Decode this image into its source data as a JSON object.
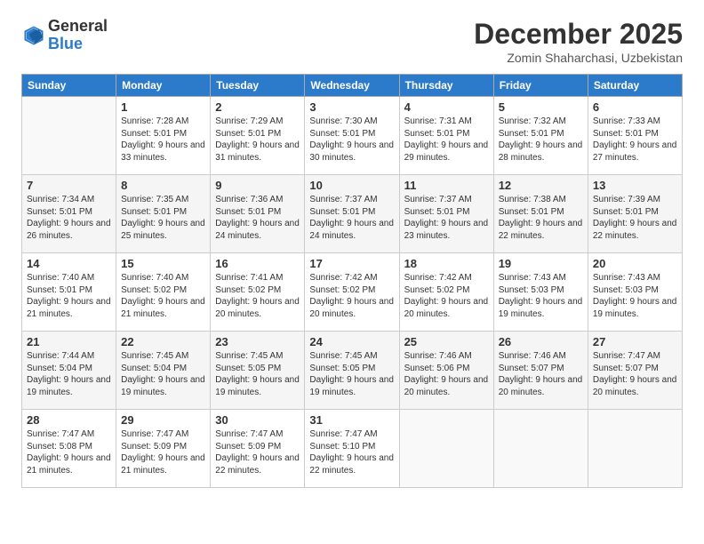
{
  "header": {
    "logo_general": "General",
    "logo_blue": "Blue",
    "month_title": "December 2025",
    "location": "Zomin Shaharchasi, Uzbekistan"
  },
  "days_of_week": [
    "Sunday",
    "Monday",
    "Tuesday",
    "Wednesday",
    "Thursday",
    "Friday",
    "Saturday"
  ],
  "weeks": [
    [
      {
        "day": "",
        "sunrise": "",
        "sunset": "",
        "daylight": ""
      },
      {
        "day": "1",
        "sunrise": "Sunrise: 7:28 AM",
        "sunset": "Sunset: 5:01 PM",
        "daylight": "Daylight: 9 hours and 33 minutes."
      },
      {
        "day": "2",
        "sunrise": "Sunrise: 7:29 AM",
        "sunset": "Sunset: 5:01 PM",
        "daylight": "Daylight: 9 hours and 31 minutes."
      },
      {
        "day": "3",
        "sunrise": "Sunrise: 7:30 AM",
        "sunset": "Sunset: 5:01 PM",
        "daylight": "Daylight: 9 hours and 30 minutes."
      },
      {
        "day": "4",
        "sunrise": "Sunrise: 7:31 AM",
        "sunset": "Sunset: 5:01 PM",
        "daylight": "Daylight: 9 hours and 29 minutes."
      },
      {
        "day": "5",
        "sunrise": "Sunrise: 7:32 AM",
        "sunset": "Sunset: 5:01 PM",
        "daylight": "Daylight: 9 hours and 28 minutes."
      },
      {
        "day": "6",
        "sunrise": "Sunrise: 7:33 AM",
        "sunset": "Sunset: 5:01 PM",
        "daylight": "Daylight: 9 hours and 27 minutes."
      }
    ],
    [
      {
        "day": "7",
        "sunrise": "Sunrise: 7:34 AM",
        "sunset": "Sunset: 5:01 PM",
        "daylight": "Daylight: 9 hours and 26 minutes."
      },
      {
        "day": "8",
        "sunrise": "Sunrise: 7:35 AM",
        "sunset": "Sunset: 5:01 PM",
        "daylight": "Daylight: 9 hours and 25 minutes."
      },
      {
        "day": "9",
        "sunrise": "Sunrise: 7:36 AM",
        "sunset": "Sunset: 5:01 PM",
        "daylight": "Daylight: 9 hours and 24 minutes."
      },
      {
        "day": "10",
        "sunrise": "Sunrise: 7:37 AM",
        "sunset": "Sunset: 5:01 PM",
        "daylight": "Daylight: 9 hours and 24 minutes."
      },
      {
        "day": "11",
        "sunrise": "Sunrise: 7:37 AM",
        "sunset": "Sunset: 5:01 PM",
        "daylight": "Daylight: 9 hours and 23 minutes."
      },
      {
        "day": "12",
        "sunrise": "Sunrise: 7:38 AM",
        "sunset": "Sunset: 5:01 PM",
        "daylight": "Daylight: 9 hours and 22 minutes."
      },
      {
        "day": "13",
        "sunrise": "Sunrise: 7:39 AM",
        "sunset": "Sunset: 5:01 PM",
        "daylight": "Daylight: 9 hours and 22 minutes."
      }
    ],
    [
      {
        "day": "14",
        "sunrise": "Sunrise: 7:40 AM",
        "sunset": "Sunset: 5:01 PM",
        "daylight": "Daylight: 9 hours and 21 minutes."
      },
      {
        "day": "15",
        "sunrise": "Sunrise: 7:40 AM",
        "sunset": "Sunset: 5:02 PM",
        "daylight": "Daylight: 9 hours and 21 minutes."
      },
      {
        "day": "16",
        "sunrise": "Sunrise: 7:41 AM",
        "sunset": "Sunset: 5:02 PM",
        "daylight": "Daylight: 9 hours and 20 minutes."
      },
      {
        "day": "17",
        "sunrise": "Sunrise: 7:42 AM",
        "sunset": "Sunset: 5:02 PM",
        "daylight": "Daylight: 9 hours and 20 minutes."
      },
      {
        "day": "18",
        "sunrise": "Sunrise: 7:42 AM",
        "sunset": "Sunset: 5:02 PM",
        "daylight": "Daylight: 9 hours and 20 minutes."
      },
      {
        "day": "19",
        "sunrise": "Sunrise: 7:43 AM",
        "sunset": "Sunset: 5:03 PM",
        "daylight": "Daylight: 9 hours and 19 minutes."
      },
      {
        "day": "20",
        "sunrise": "Sunrise: 7:43 AM",
        "sunset": "Sunset: 5:03 PM",
        "daylight": "Daylight: 9 hours and 19 minutes."
      }
    ],
    [
      {
        "day": "21",
        "sunrise": "Sunrise: 7:44 AM",
        "sunset": "Sunset: 5:04 PM",
        "daylight": "Daylight: 9 hours and 19 minutes."
      },
      {
        "day": "22",
        "sunrise": "Sunrise: 7:45 AM",
        "sunset": "Sunset: 5:04 PM",
        "daylight": "Daylight: 9 hours and 19 minutes."
      },
      {
        "day": "23",
        "sunrise": "Sunrise: 7:45 AM",
        "sunset": "Sunset: 5:05 PM",
        "daylight": "Daylight: 9 hours and 19 minutes."
      },
      {
        "day": "24",
        "sunrise": "Sunrise: 7:45 AM",
        "sunset": "Sunset: 5:05 PM",
        "daylight": "Daylight: 9 hours and 19 minutes."
      },
      {
        "day": "25",
        "sunrise": "Sunrise: 7:46 AM",
        "sunset": "Sunset: 5:06 PM",
        "daylight": "Daylight: 9 hours and 20 minutes."
      },
      {
        "day": "26",
        "sunrise": "Sunrise: 7:46 AM",
        "sunset": "Sunset: 5:07 PM",
        "daylight": "Daylight: 9 hours and 20 minutes."
      },
      {
        "day": "27",
        "sunrise": "Sunrise: 7:47 AM",
        "sunset": "Sunset: 5:07 PM",
        "daylight": "Daylight: 9 hours and 20 minutes."
      }
    ],
    [
      {
        "day": "28",
        "sunrise": "Sunrise: 7:47 AM",
        "sunset": "Sunset: 5:08 PM",
        "daylight": "Daylight: 9 hours and 21 minutes."
      },
      {
        "day": "29",
        "sunrise": "Sunrise: 7:47 AM",
        "sunset": "Sunset: 5:09 PM",
        "daylight": "Daylight: 9 hours and 21 minutes."
      },
      {
        "day": "30",
        "sunrise": "Sunrise: 7:47 AM",
        "sunset": "Sunset: 5:09 PM",
        "daylight": "Daylight: 9 hours and 22 minutes."
      },
      {
        "day": "31",
        "sunrise": "Sunrise: 7:47 AM",
        "sunset": "Sunset: 5:10 PM",
        "daylight": "Daylight: 9 hours and 22 minutes."
      },
      {
        "day": "",
        "sunrise": "",
        "sunset": "",
        "daylight": ""
      },
      {
        "day": "",
        "sunrise": "",
        "sunset": "",
        "daylight": ""
      },
      {
        "day": "",
        "sunrise": "",
        "sunset": "",
        "daylight": ""
      }
    ]
  ]
}
